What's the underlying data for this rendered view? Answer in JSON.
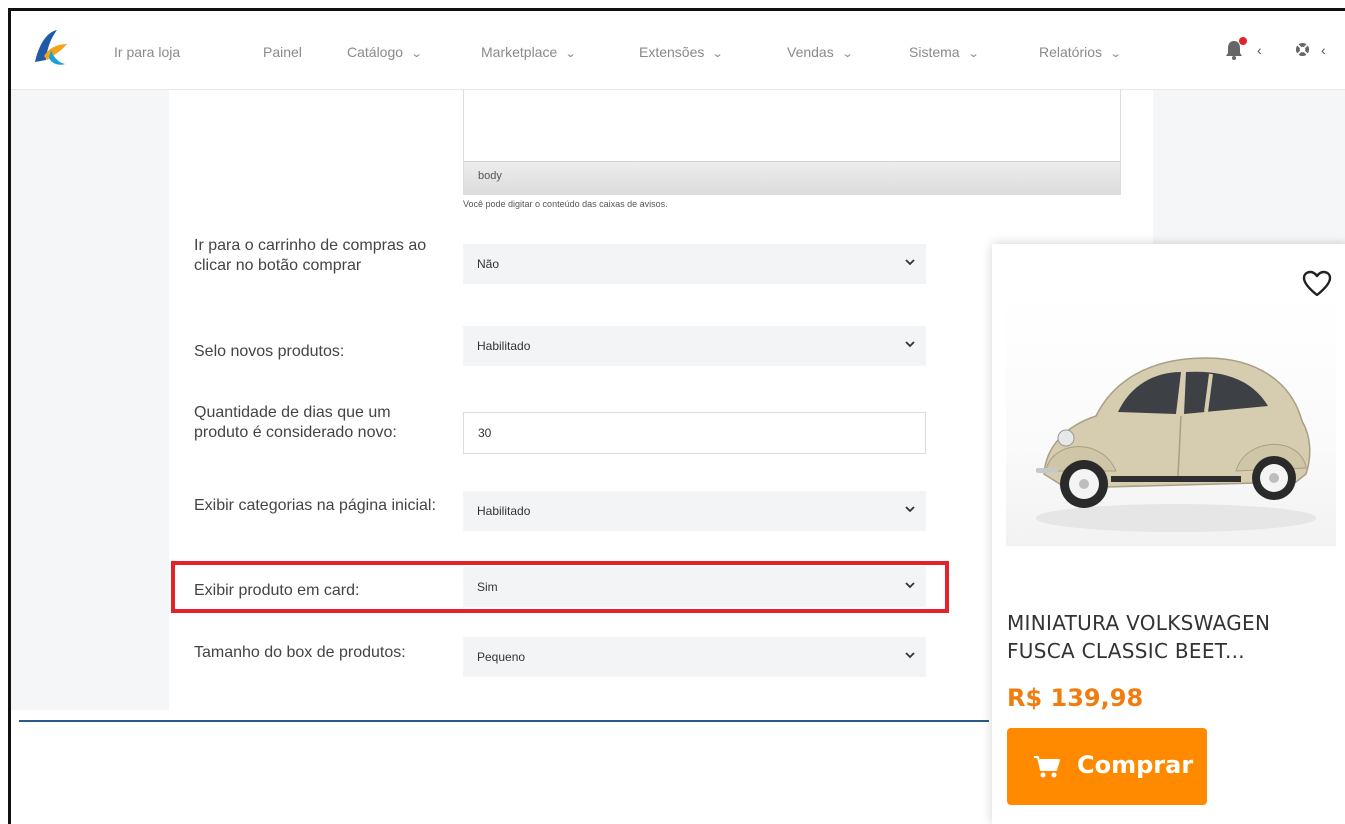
{
  "nav": {
    "store_link": "Ir para loja",
    "items": [
      {
        "label": "Painel",
        "dropdown": false
      },
      {
        "label": "Catálogo",
        "dropdown": true
      },
      {
        "label": "Marketplace",
        "dropdown": true
      },
      {
        "label": "Extensões",
        "dropdown": true
      },
      {
        "label": "Vendas",
        "dropdown": true
      },
      {
        "label": "Sistema",
        "dropdown": true
      },
      {
        "label": "Relatórios",
        "dropdown": true
      }
    ],
    "chevron": "⌄",
    "caret": "‹",
    "icons": [
      "logo-icon",
      "bell-icon",
      "help-icon"
    ]
  },
  "editor": {
    "status_path": "body",
    "help_text": "Você pode digitar o conteúdo das caixas de avisos."
  },
  "fields": [
    {
      "label": "Ir para o carrinho de compras ao clicar no botão comprar",
      "type": "select",
      "value": "Não"
    },
    {
      "label": "Selo novos produtos:",
      "type": "select",
      "value": "Habilitado"
    },
    {
      "label": "Quantidade de dias que um produto é considerado novo:",
      "type": "input",
      "value": "30"
    },
    {
      "label": "Exibir categorias na página inicial:",
      "type": "select",
      "value": "Habilitado"
    },
    {
      "label": "Exibir produto em card:",
      "type": "select",
      "value": "Sim"
    },
    {
      "label": "Tamanho do box de produtos:",
      "type": "select",
      "value": "Pequeno"
    }
  ],
  "card": {
    "title": "MINIATURA VOLKSWAGEN FUSCA CLASSIC BEET...",
    "price": "R$ 139,98",
    "button_label": "Comprar",
    "icons": [
      "heart-icon",
      "cart-icon"
    ]
  },
  "colors": {
    "highlight": "#e3222a",
    "accent_orange": "#ff8a00",
    "price": "#f07d0f",
    "notification_dot": "#e0232b"
  }
}
